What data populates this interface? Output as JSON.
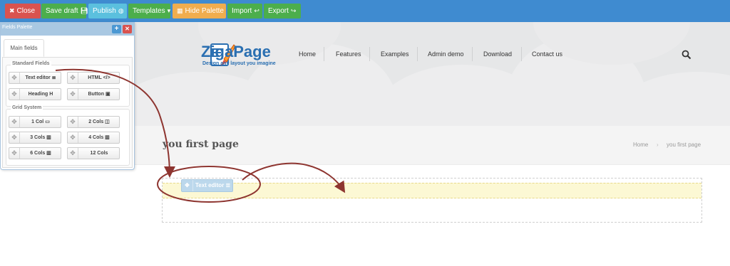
{
  "toolbar": {
    "close": {
      "label": "Close",
      "icon": "times-icon"
    },
    "save_draft": {
      "label": "Save draft",
      "icon": "floppy-icon"
    },
    "publish": {
      "label": "Publish",
      "icon": "globe-icon"
    },
    "templates": {
      "label": "Templates",
      "icon": "caret-down-icon"
    },
    "hide_palette": {
      "label": "Hide Palette",
      "icon": "table-icon"
    },
    "import": {
      "label": "Import",
      "icon": "reply-icon"
    },
    "export": {
      "label": "Export",
      "icon": "share-icon"
    }
  },
  "colors": {
    "toolbar_bg": "#3f8bd0",
    "danger": "#d9534f",
    "success": "#4cae4c",
    "info": "#5bc0de",
    "warning": "#f0ad4e",
    "brand": "#2a6fb1",
    "arrow": "#8e3530"
  },
  "site": {
    "logo_title": "ZigaPage",
    "logo_tagline": "Design any layout you imagine",
    "nav": [
      "Home",
      "Features",
      "Examples",
      "Admin demo",
      "Download",
      "Contact us"
    ],
    "page_title": "you first page",
    "breadcrumb": {
      "home": "Home",
      "separator": "›",
      "current": "you first page"
    }
  },
  "palette": {
    "title": "Fields Palette",
    "add_icon": "plus",
    "close_icon": "x",
    "tab": "Main fields",
    "standard_fields": {
      "legend": "Standard Fields",
      "items": [
        {
          "label": "Text editor",
          "icon": "≣"
        },
        {
          "label": "HTML",
          "icon": "</>"
        },
        {
          "label": "Heading",
          "icon": "H"
        },
        {
          "label": "Button",
          "icon": "▣"
        }
      ]
    },
    "grid_system": {
      "legend": "Grid System",
      "items": [
        {
          "label": "1 Col",
          "icon": "▭"
        },
        {
          "label": "2 Cols",
          "icon": "◫"
        },
        {
          "label": "3 Cols",
          "icon": "▥"
        },
        {
          "label": "4 Cols",
          "icon": "▥"
        },
        {
          "label": "6 Cols",
          "icon": "▥"
        },
        {
          "label": "12 Cols",
          "icon": ""
        }
      ]
    }
  },
  "canvas": {
    "dragged_item": {
      "label": "Text editor",
      "icon": "≣"
    }
  }
}
